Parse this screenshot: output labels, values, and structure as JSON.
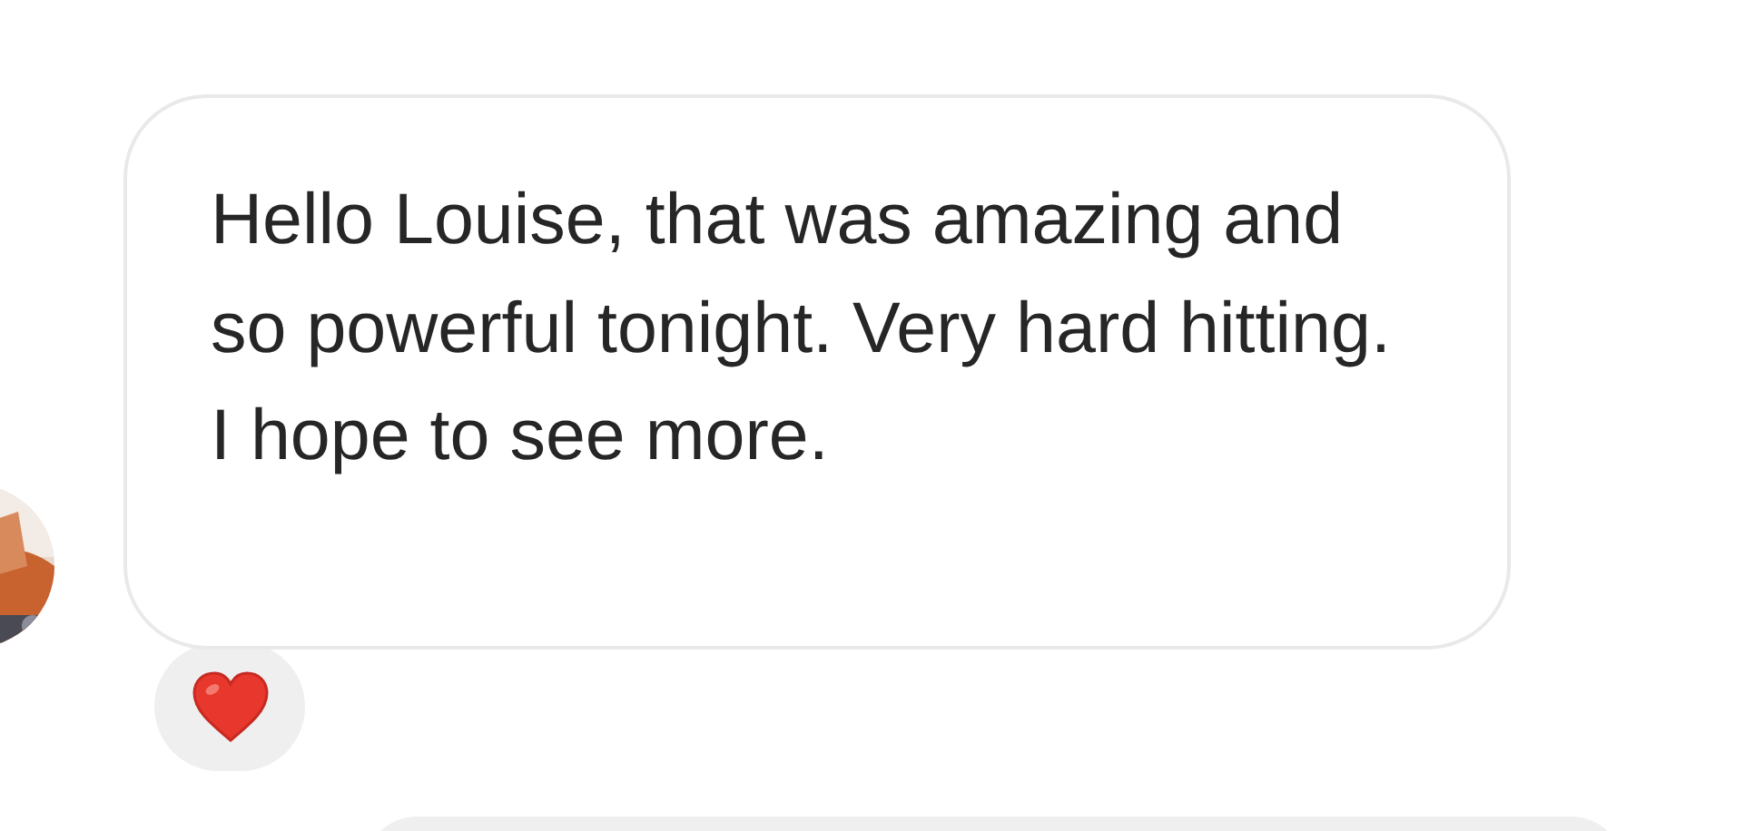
{
  "messages": [
    {
      "kind": "received",
      "text": "Hello Louise, that was amazing and so powerful tonight. Very hard hitting. I hope to see more.",
      "reaction": {
        "kind": "heart"
      }
    },
    {
      "kind": "sent"
    }
  ]
}
